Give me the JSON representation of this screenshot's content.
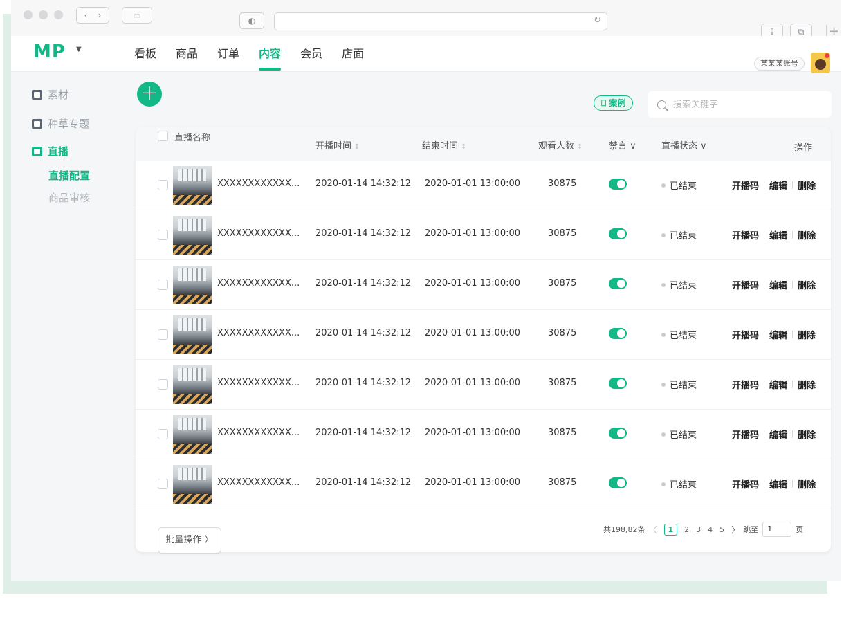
{
  "header": {
    "logo": "MP",
    "nav": [
      "看板",
      "商品",
      "订单",
      "内容",
      "会员",
      "店面"
    ],
    "nav_active": 3,
    "account": "某某某账号"
  },
  "sidebar": {
    "items": [
      {
        "label": "素材",
        "icon": "image-icon"
      },
      {
        "label": "种草专题",
        "icon": "topic-icon"
      },
      {
        "label": "直播",
        "icon": "live-icon",
        "active": true
      }
    ],
    "subitems": [
      {
        "label": "直播配置",
        "active": true
      },
      {
        "label": "商品审核",
        "active": false
      }
    ]
  },
  "toolbar": {
    "case_label": "案例",
    "search_placeholder": "搜索关键字"
  },
  "table": {
    "columns": [
      "直播名称",
      "开播时间",
      "结束时间",
      "观看人数",
      "禁言",
      "直播状态",
      "操作"
    ],
    "rows": [
      {
        "name": "XXXXXXXXXXXX...",
        "start": "2020-01-14 14:32:12",
        "end": "2020-01-01 13:00:00",
        "viewers": "30875",
        "mute": true,
        "status": "已结束"
      },
      {
        "name": "XXXXXXXXXXXX...",
        "start": "2020-01-14 14:32:12",
        "end": "2020-01-01 13:00:00",
        "viewers": "30875",
        "mute": true,
        "status": "已结束"
      },
      {
        "name": "XXXXXXXXXXXX...",
        "start": "2020-01-14 14:32:12",
        "end": "2020-01-01 13:00:00",
        "viewers": "30875",
        "mute": true,
        "status": "已结束"
      },
      {
        "name": "XXXXXXXXXXXX...",
        "start": "2020-01-14 14:32:12",
        "end": "2020-01-01 13:00:00",
        "viewers": "30875",
        "mute": true,
        "status": "已结束"
      },
      {
        "name": "XXXXXXXXXXXX...",
        "start": "2020-01-14 14:32:12",
        "end": "2020-01-01 13:00:00",
        "viewers": "30875",
        "mute": true,
        "status": "已结束"
      },
      {
        "name": "XXXXXXXXXXXX...",
        "start": "2020-01-14 14:32:12",
        "end": "2020-01-01 13:00:00",
        "viewers": "30875",
        "mute": true,
        "status": "已结束"
      },
      {
        "name": "XXXXXXXXXXXX...",
        "start": "2020-01-14 14:32:12",
        "end": "2020-01-01 13:00:00",
        "viewers": "30875",
        "mute": true,
        "status": "已结束"
      }
    ],
    "ops": [
      "开播码",
      "编辑",
      "删除"
    ]
  },
  "footer": {
    "batch_label": "批量操作 〉",
    "total": "共198,82条",
    "pages": [
      "1",
      "2",
      "3",
      "4",
      "5"
    ],
    "current_page": "1",
    "jump_label": "跳至",
    "jump_value": "1",
    "page_unit": "页"
  },
  "colors": {
    "accent": "#12b886",
    "background": "#f5f6f8"
  }
}
